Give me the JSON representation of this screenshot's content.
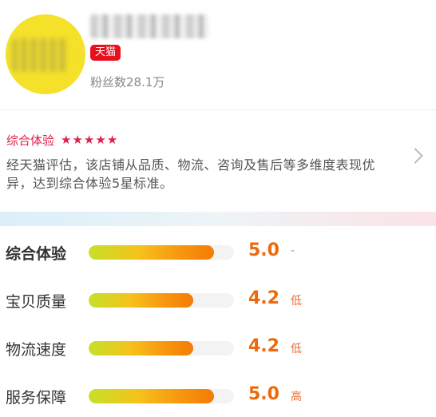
{
  "shop": {
    "badge": "天猫",
    "followers_text": "粉丝数28.1万"
  },
  "experience": {
    "title": "综合体验",
    "star_count": 5,
    "description": "经天猫评估，该店铺从品质、物流、咨询及售后等多维度表现优异，达到综合体验5星标准。"
  },
  "ratings": [
    {
      "label": "综合体验",
      "score": "5.0",
      "fill_fraction": 0.86,
      "level": "-"
    },
    {
      "label": "宝贝质量",
      "score": "4.2",
      "fill_fraction": 0.72,
      "level": "低"
    },
    {
      "label": "物流速度",
      "score": "4.2",
      "fill_fraction": 0.72,
      "level": "低"
    },
    {
      "label": "服务保障",
      "score": "5.0",
      "fill_fraction": 0.86,
      "level": "高"
    }
  ],
  "colors": {
    "tmall_red": "#e8101c",
    "accent_pink": "#e0204c",
    "score_orange": "#f0680a"
  },
  "icons": {
    "chevron": "chevron-right-icon",
    "star": "star-icon"
  }
}
